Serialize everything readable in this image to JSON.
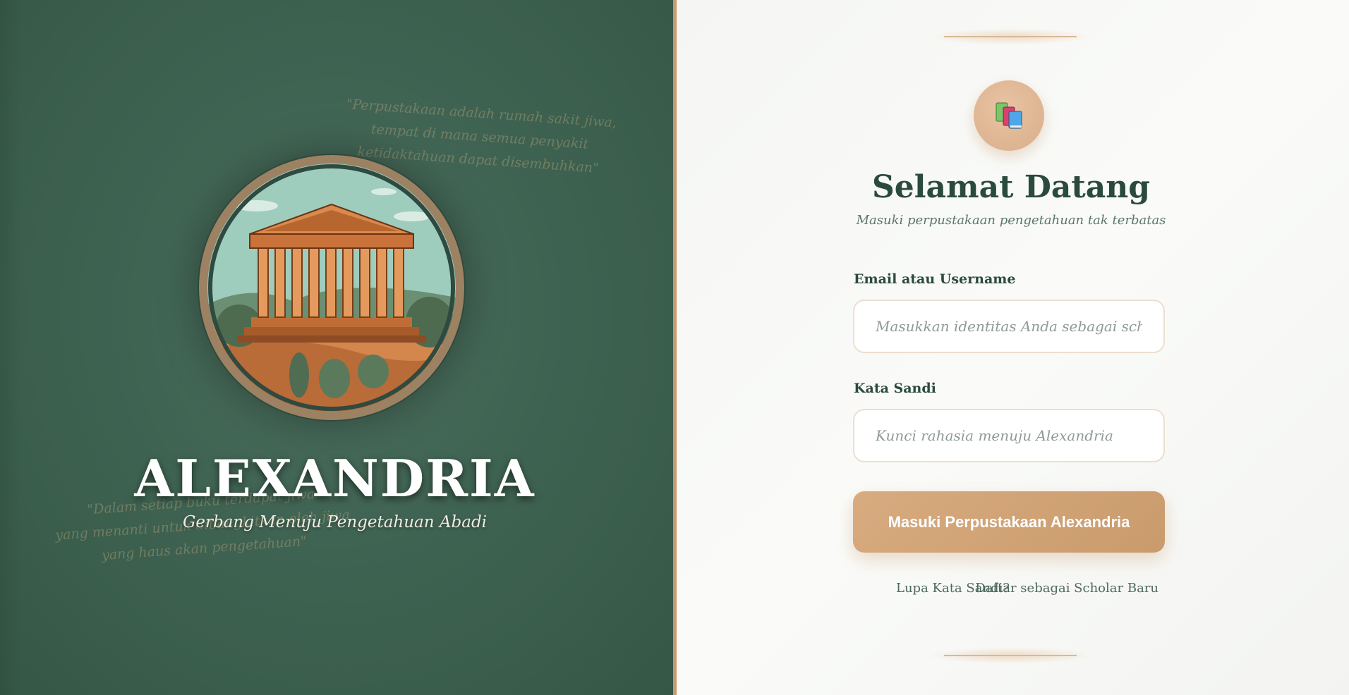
{
  "brand": {
    "title": "ALEXANDRIA",
    "subtitle": "Gerbang Menuju Pengetahuan Abadi",
    "quote_top": [
      "\"Perpustakaan adalah rumah sakit jiwa,",
      "tempat di mana semua penyakit",
      "ketidaktahuan dapat disembuhkan\""
    ],
    "quote_bottom": [
      "\"Dalam setiap buku terdapat jiwa",
      "yang menanti untuk dibangkitkan oleh jiwa",
      "yang haus akan pengetahuan\""
    ],
    "emblem_icon": "greek-temple-illustration"
  },
  "login": {
    "logo_icon": "books-icon",
    "title": "Selamat Datang",
    "tagline": "Masuki perpustakaan pengetahuan tak terbatas",
    "email_label": "Email atau Username",
    "email_placeholder": "Masukkan identitas Anda sebagai scholar",
    "email_value": "",
    "password_label": "Kata Sandi",
    "password_placeholder": "Kunci rahasia menuju Alexandria",
    "password_value": "",
    "submit_label": "Masuki Perpustakaan Alexandria",
    "forgot_link": "Lupa Kata Sandi?",
    "register_link": "Daftar sebagai Scholar Baru"
  },
  "colors": {
    "panel_green": "#3f6352",
    "accent_tan": "#c99b6c",
    "heading_green": "#2b4a3f"
  }
}
